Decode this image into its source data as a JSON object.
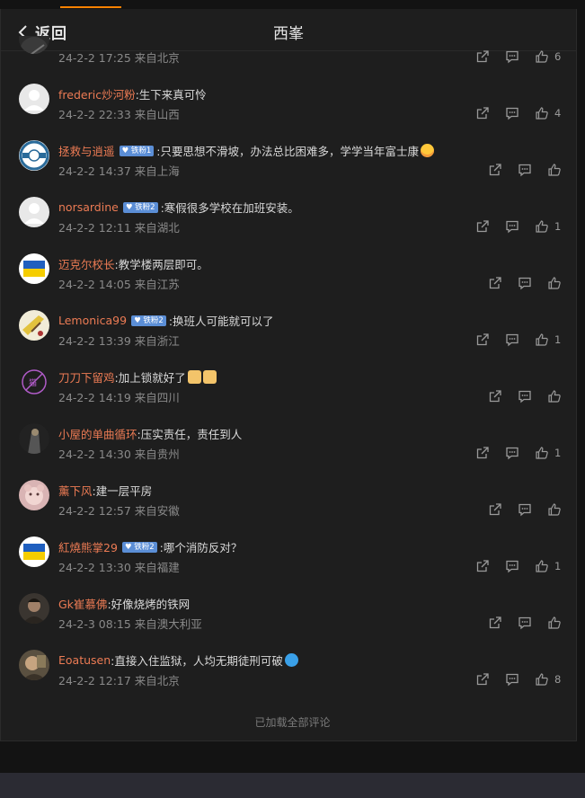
{
  "header": {
    "back_label": "返回",
    "title": "西峯"
  },
  "comments": [
    {
      "user": "",
      "badge": "",
      "text": "",
      "time": "24-2-2 17:25 来自北京",
      "likes": "6",
      "avatar": "partial"
    },
    {
      "user": "frederic炒河粉",
      "badge": "",
      "text": ":生下来真可怜",
      "time": "24-2-2 22:33 来自山西",
      "likes": "4",
      "avatar": "default"
    },
    {
      "user": "拯救与逍遥",
      "badge": "铁粉1",
      "text": ":只要思想不滑坡，办法总比困难多，学学当年富士康",
      "time": "24-2-2 14:37 来自上海",
      "likes": "",
      "avatar": "blue-logo",
      "emoji": "blush"
    },
    {
      "user": "norsardine",
      "badge": "铁粉2",
      "text": ":寒假很多学校在加班安装。",
      "time": "24-2-2 12:11 来自湖北",
      "likes": "1",
      "avatar": "default"
    },
    {
      "user": "迈克尔校长",
      "badge": "",
      "text": ":教学楼两层即可。",
      "time": "24-2-2 14:05 来自江苏",
      "likes": "",
      "avatar": "flag"
    },
    {
      "user": "Lemonica99",
      "badge": "铁粉2",
      "text": ":换班人可能就可以了",
      "time": "24-2-2 13:39 来自浙江",
      "likes": "1",
      "avatar": "drawing"
    },
    {
      "user": "刀刀下留鸡",
      "badge": "",
      "text": ":加上锁就好了",
      "time": "24-2-2 14:19 来自四川",
      "likes": "",
      "avatar": "purple",
      "emoji": "cats"
    },
    {
      "user": "小屋的单曲循环",
      "badge": "",
      "text": ":压实责任，责任到人",
      "time": "24-2-2 14:30 来自贵州",
      "likes": "1",
      "avatar": "dark-photo"
    },
    {
      "user": "薰下风",
      "badge": "",
      "text": ":建一层平房",
      "time": "24-2-2 12:57 来自安徽",
      "likes": "",
      "avatar": "pink"
    },
    {
      "user": "紅燒熊掌29",
      "badge": "铁粉2",
      "text": ":哪个消防反对？",
      "time": "24-2-2 13:30 来自福建",
      "likes": "1",
      "avatar": "flag"
    },
    {
      "user": "Gk崔慕佛",
      "badge": "",
      "text": ":好像烧烤的铁网",
      "time": "24-2-3 08:15 来自澳大利亚",
      "likes": "",
      "avatar": "portrait"
    },
    {
      "user": "Eoatusen",
      "badge": "",
      "text": ":直接入住监狱，人均无期徒刑可破",
      "time": "24-2-2 12:17 来自北京",
      "likes": "8",
      "avatar": "portrait2",
      "emoji": "wave"
    }
  ],
  "footer": {
    "text": "已加载全部评论"
  },
  "colors": {
    "accent": "#ff8200",
    "username": "#ec7b54",
    "badge": "#5b8ed6"
  }
}
